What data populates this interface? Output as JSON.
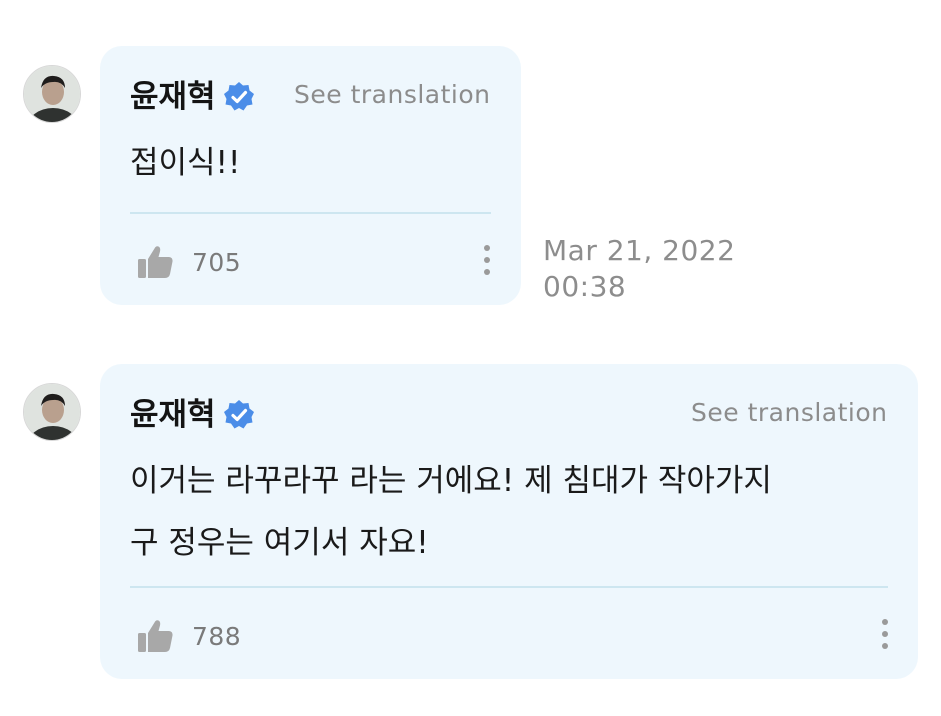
{
  "comments": [
    {
      "author": "윤재혁",
      "translate_label": "See translation",
      "text_lines": [
        "접이식!!"
      ],
      "likes": "705",
      "date": "Mar 21, 2022",
      "time": "00:38"
    },
    {
      "author": "윤재혁",
      "translate_label": "See translation",
      "text_lines": [
        "이거는 라꾸라꾸 라는 거에요! 제 침대가 작아가지",
        "구 정우는 여기서 자요!"
      ],
      "likes": "788"
    }
  ],
  "icons": {
    "verified": "verified-badge-icon",
    "like": "thumbs-up-icon",
    "more": "more-vertical-icon",
    "avatar": "profile-avatar"
  },
  "colors": {
    "bubble_bg": "#eef7fd",
    "verified_blue": "#4b8de8",
    "divider": "#cde6f0",
    "muted_text": "#8c8c8c"
  }
}
